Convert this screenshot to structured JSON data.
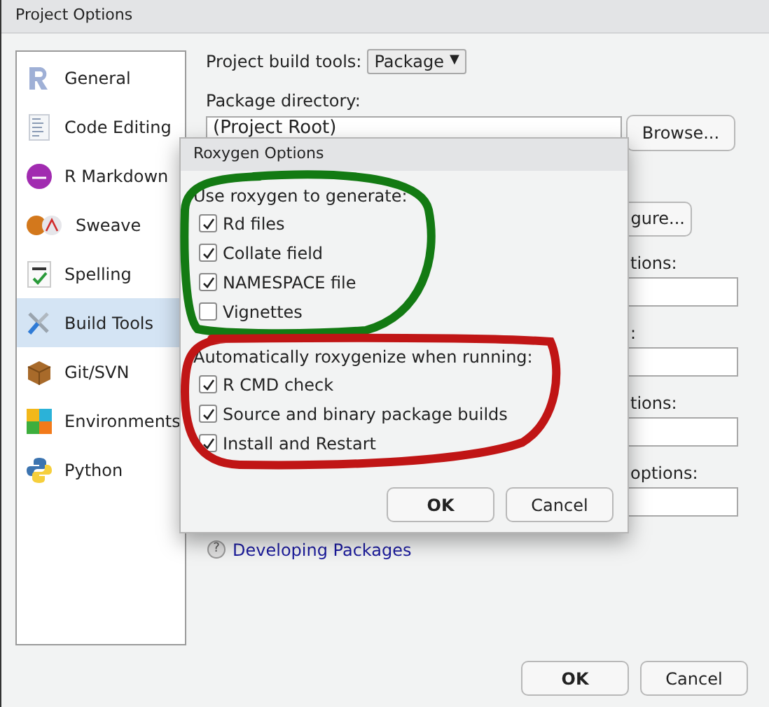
{
  "window": {
    "title": "Project Options"
  },
  "sidebar": {
    "items": [
      {
        "label": "General",
        "selected": false
      },
      {
        "label": "Code Editing",
        "selected": false
      },
      {
        "label": "R Markdown",
        "selected": false
      },
      {
        "label": "Sweave",
        "selected": false
      },
      {
        "label": "Spelling",
        "selected": false
      },
      {
        "label": "Build Tools",
        "selected": true
      },
      {
        "label": "Git/SVN",
        "selected": false
      },
      {
        "label": "Environments",
        "selected": false
      },
      {
        "label": "Python",
        "selected": false
      }
    ]
  },
  "build_tools": {
    "label": "Project build tools:",
    "value": "Package",
    "caret": "▼"
  },
  "package_directory": {
    "label": "Package directory:",
    "value": "(Project Root)",
    "button": "Browse..."
  },
  "configure_button": "gure...",
  "option_fields": [
    {
      "label": "tions:"
    },
    {
      "label": ":"
    },
    {
      "label": "tions:"
    },
    {
      "label": "options:"
    }
  ],
  "help_link": {
    "icon": "?",
    "label": "Developing Packages"
  },
  "buttons": [
    {
      "label": "OK",
      "default": true
    },
    {
      "label": "Cancel",
      "default": false
    }
  ],
  "roxygen_dialog": {
    "title": "Roxygen Options",
    "sections": [
      {
        "heading": "Use roxygen to generate:",
        "options": [
          {
            "label": "Rd files",
            "checked": true
          },
          {
            "label": "Collate field",
            "checked": true
          },
          {
            "label": "NAMESPACE file",
            "checked": true
          },
          {
            "label": "Vignettes",
            "checked": false
          }
        ]
      },
      {
        "heading": "Automatically roxygenize when running:",
        "options": [
          {
            "label": "R CMD check",
            "checked": true
          },
          {
            "label": "Source and binary package builds",
            "checked": true
          },
          {
            "label": "Install and Restart",
            "checked": true
          }
        ]
      }
    ],
    "buttons": [
      {
        "label": "OK",
        "default": true
      },
      {
        "label": "Cancel",
        "default": false
      }
    ]
  },
  "annotations": [
    {
      "color": "#137a13"
    },
    {
      "color": "#c01515"
    }
  ]
}
